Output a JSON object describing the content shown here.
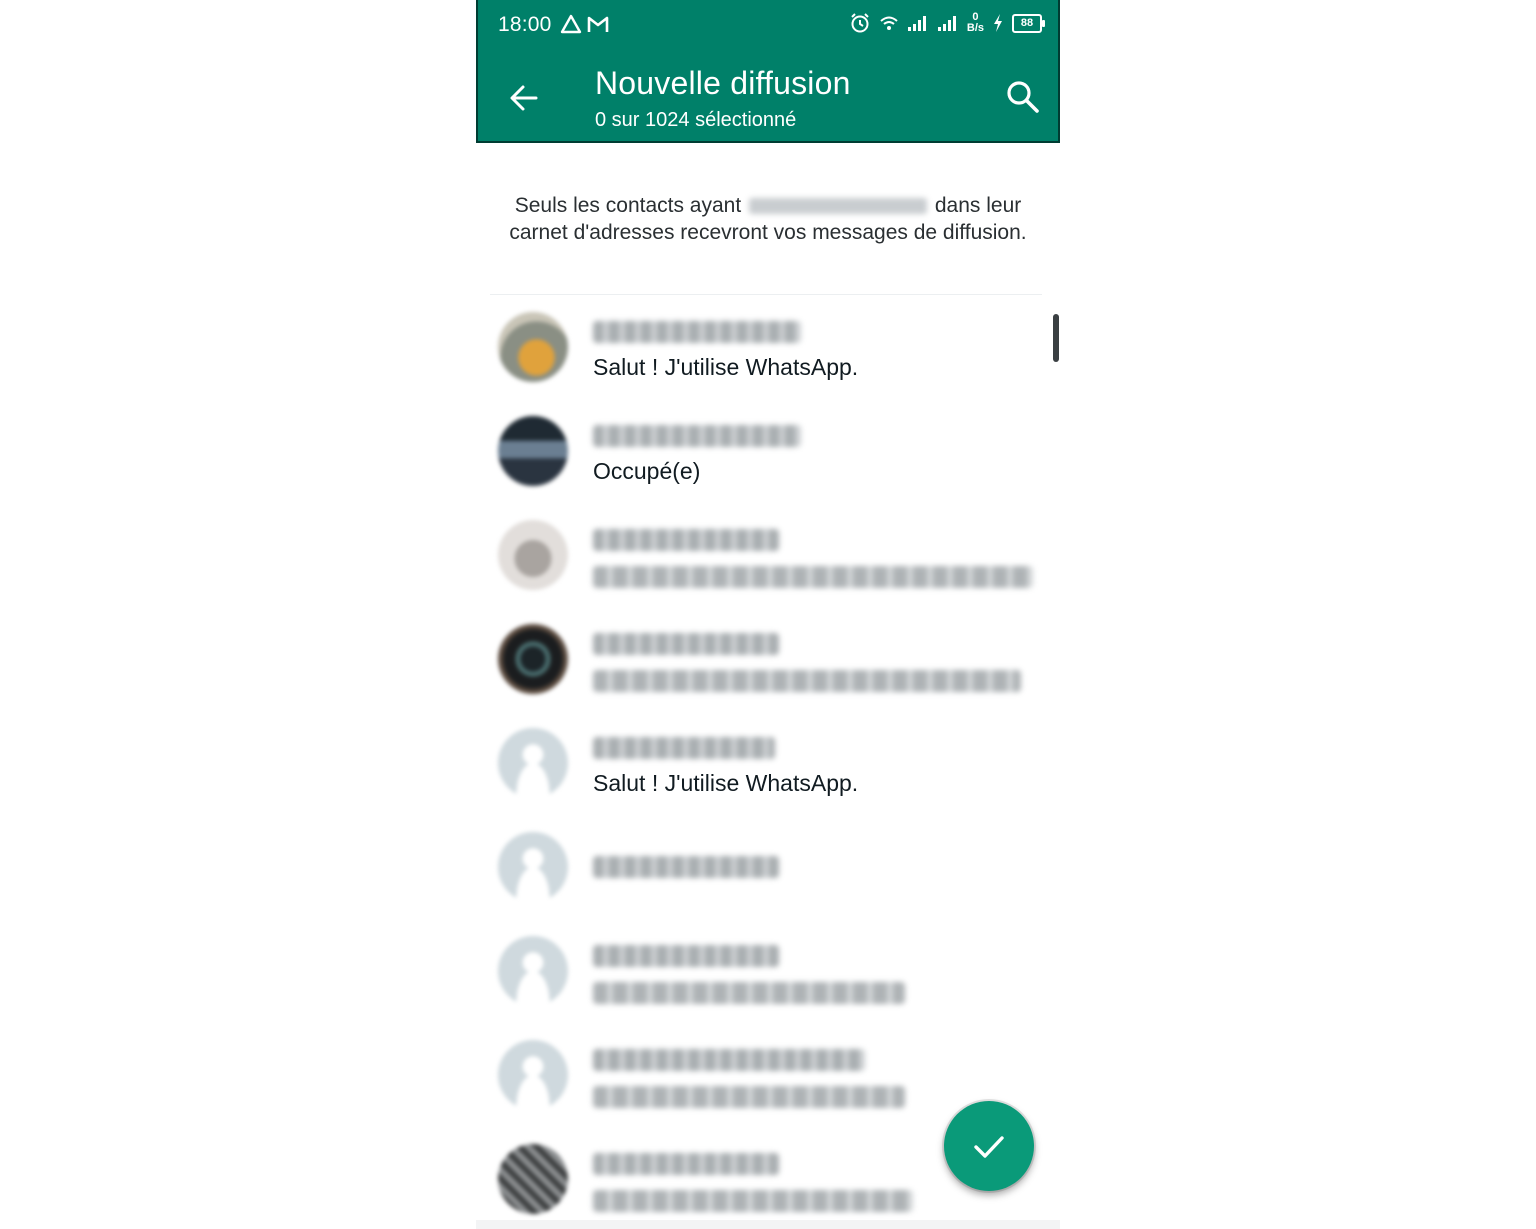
{
  "status_bar": {
    "time": "18:00",
    "left_icons": [
      "warning-triangle-icon",
      "gmail-icon"
    ],
    "right_icons": [
      "alarm-icon",
      "wifi-icon",
      "signal-icon",
      "signal-icon",
      "network-speed-icon",
      "charging-icon",
      "battery-icon"
    ],
    "net_speed_value": "0",
    "net_speed_unit": "B/s",
    "battery_level": "88"
  },
  "header": {
    "title": "Nouvelle diffusion",
    "subtitle": "0 sur 1024 sélectionné",
    "back_icon": "arrow-left-icon",
    "search_icon": "search-icon",
    "color": "#008069"
  },
  "info": {
    "text_before": "Seuls les contacts ayant",
    "text_after": "dans leur",
    "line2": "carnet d'adresses recevront vos messages de diffusion."
  },
  "contacts": [
    {
      "status": "Salut ! J'utilise WhatsApp."
    },
    {
      "status": "Occupé(e)"
    },
    {
      "status": ""
    },
    {
      "status": ""
    },
    {
      "status": "Salut ! J'utilise WhatsApp."
    },
    {
      "status": ""
    },
    {
      "status": ""
    },
    {
      "status": ""
    },
    {
      "status": ""
    }
  ],
  "fab": {
    "icon": "checkmark-icon",
    "color": "#0a9a79"
  }
}
